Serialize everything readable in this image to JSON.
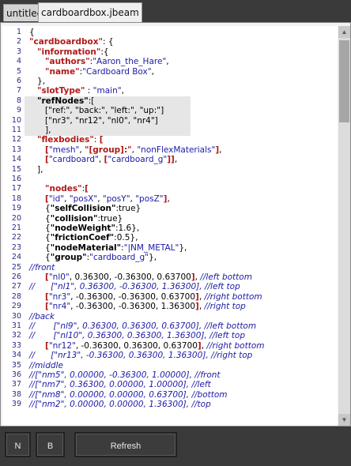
{
  "tabs": [
    {
      "label": "untitled",
      "active": false
    },
    {
      "label": "cardboardbox.jbeam",
      "active": true
    }
  ],
  "buttons": {
    "n": "N",
    "b": "B",
    "refresh": "Refresh"
  },
  "colors": {
    "key": "#b01818",
    "string": "#1a1aa6",
    "comment": "#1a1aa6",
    "linenumber": "#2b2b8a"
  },
  "lines": [
    {
      "n": "1",
      "t": [
        [
          "p",
          "{"
        ]
      ]
    },
    {
      "n": "2",
      "t": [
        [
          "k",
          "\"cardboardbox\""
        ],
        [
          "p",
          ": {"
        ]
      ]
    },
    {
      "n": "3",
      "t": [
        [
          "p",
          "   "
        ],
        [
          "k",
          "\"information\""
        ],
        [
          "p",
          ":{"
        ]
      ]
    },
    {
      "n": "4",
      "t": [
        [
          "p",
          "      "
        ],
        [
          "k",
          "\"authors\""
        ],
        [
          "p",
          ":"
        ],
        [
          "s",
          "\"Aaron_the_Hare\""
        ],
        [
          "p",
          ","
        ]
      ]
    },
    {
      "n": "5",
      "t": [
        [
          "p",
          "      "
        ],
        [
          "k",
          "\"name\""
        ],
        [
          "p",
          ":"
        ],
        [
          "s",
          "\"Cardboard Box\""
        ],
        [
          "p",
          ","
        ]
      ]
    },
    {
      "n": "6",
      "t": [
        [
          "p",
          "   },"
        ]
      ]
    },
    {
      "n": "7",
      "t": [
        [
          "p",
          "   "
        ],
        [
          "k",
          "\"slotType\""
        ],
        [
          "p",
          " : "
        ],
        [
          "s",
          "\"main\""
        ],
        [
          "p",
          ","
        ]
      ]
    },
    {
      "n": "8",
      "hl": true,
      "t": [
        [
          "p",
          "   "
        ],
        [
          "kb",
          "\"refNodes\""
        ],
        [
          "p",
          ":["
        ]
      ]
    },
    {
      "n": "9",
      "hl": true,
      "t": [
        [
          "p",
          "      [\"ref:\", \"back:\", \"left:\", \"up:\"]"
        ]
      ]
    },
    {
      "n": "10",
      "hl": true,
      "t": [
        [
          "p",
          "      [\"nr3\", \"nr12\", \"nl0\", \"nr4\"]"
        ]
      ]
    },
    {
      "n": "11",
      "hl": true,
      "t": [
        [
          "p",
          "      ],"
        ]
      ]
    },
    {
      "n": "12",
      "t": [
        [
          "p",
          "   "
        ],
        [
          "k",
          "\"flexbodies\""
        ],
        [
          "p",
          ": "
        ],
        [
          "o",
          "["
        ]
      ]
    },
    {
      "n": "13",
      "t": [
        [
          "p",
          "      "
        ],
        [
          "o",
          "["
        ],
        [
          "s",
          "\"mesh\""
        ],
        [
          "p",
          ", "
        ],
        [
          "o",
          "\"[group]:\""
        ],
        [
          "p",
          ", "
        ],
        [
          "s",
          "\"nonFlexMaterials\""
        ],
        [
          "o",
          "]"
        ],
        [
          "p",
          ","
        ]
      ]
    },
    {
      "n": "14",
      "t": [
        [
          "p",
          "      "
        ],
        [
          "o",
          "["
        ],
        [
          "s",
          "\"cardboard\""
        ],
        [
          "p",
          ", "
        ],
        [
          "o",
          "["
        ],
        [
          "s",
          "\"cardboard_g\""
        ],
        [
          "o",
          "]]"
        ],
        [
          "p",
          ","
        ]
      ]
    },
    {
      "n": "15",
      "t": [
        [
          "p",
          "   ],"
        ]
      ]
    },
    {
      "n": "16",
      "t": [
        [
          "p",
          ""
        ]
      ]
    },
    {
      "n": "17",
      "t": [
        [
          "p",
          "      "
        ],
        [
          "k",
          "\"nodes\""
        ],
        [
          "p",
          ":"
        ],
        [
          "o",
          "["
        ]
      ]
    },
    {
      "n": "18",
      "t": [
        [
          "p",
          "      "
        ],
        [
          "o",
          "["
        ],
        [
          "s",
          "\"id\""
        ],
        [
          "p",
          ", "
        ],
        [
          "s",
          "\"posX\""
        ],
        [
          "p",
          ", "
        ],
        [
          "s",
          "\"posY\""
        ],
        [
          "p",
          ", "
        ],
        [
          "s",
          "\"posZ\""
        ],
        [
          "o",
          "]"
        ],
        [
          "p",
          ","
        ]
      ]
    },
    {
      "n": "19",
      "t": [
        [
          "p",
          "      {"
        ],
        [
          "kb",
          "\"selfCollision\""
        ],
        [
          "p",
          ":true}"
        ]
      ]
    },
    {
      "n": "20",
      "t": [
        [
          "p",
          "      {"
        ],
        [
          "kb",
          "\"collision\""
        ],
        [
          "p",
          ":true}"
        ]
      ]
    },
    {
      "n": "21",
      "t": [
        [
          "p",
          "      {"
        ],
        [
          "kb",
          "\"nodeWeight\""
        ],
        [
          "p",
          ":1.6},"
        ]
      ]
    },
    {
      "n": "22",
      "t": [
        [
          "p",
          "      {"
        ],
        [
          "kb",
          "\"frictionCoef\""
        ],
        [
          "p",
          ":0.5},"
        ]
      ]
    },
    {
      "n": "23",
      "t": [
        [
          "p",
          "      {"
        ],
        [
          "kb",
          "\"nodeMaterial\""
        ],
        [
          "p",
          ":"
        ],
        [
          "s",
          "\"|NM_METAL\""
        ],
        [
          "p",
          "},"
        ]
      ]
    },
    {
      "n": "24",
      "t": [
        [
          "p",
          "      {"
        ],
        [
          "kb",
          "\"group\""
        ],
        [
          "p",
          ":"
        ],
        [
          "s",
          "\"cardboard_g\""
        ],
        [
          "p",
          "},"
        ]
      ]
    },
    {
      "n": "25",
      "t": [
        [
          "c",
          "//front"
        ]
      ]
    },
    {
      "n": "26",
      "t": [
        [
          "p",
          "      "
        ],
        [
          "o",
          "["
        ],
        [
          "s",
          "\"nl0\""
        ],
        [
          "p",
          ", 0.36300, -0.36300, 0.63700"
        ],
        [
          "o",
          "]"
        ],
        [
          "p",
          ", "
        ],
        [
          "c",
          "//left bottom"
        ]
      ]
    },
    {
      "n": "27",
      "t": [
        [
          "c",
          "//      [\"nl1\", 0.36300, -0.36300, 1.36300], //left top"
        ]
      ]
    },
    {
      "n": "28",
      "t": [
        [
          "p",
          "      "
        ],
        [
          "o",
          "["
        ],
        [
          "s",
          "\"nr3\""
        ],
        [
          "p",
          ", -0.36300, -0.36300, 0.63700"
        ],
        [
          "o",
          "]"
        ],
        [
          "p",
          ", "
        ],
        [
          "c",
          "//right bottom"
        ]
      ]
    },
    {
      "n": "29",
      "t": [
        [
          "p",
          "      "
        ],
        [
          "o",
          "["
        ],
        [
          "s",
          "\"nr4\""
        ],
        [
          "p",
          ", -0.36300, -0.36300, 1.36300"
        ],
        [
          "o",
          "]"
        ],
        [
          "p",
          ", "
        ],
        [
          "c",
          "//right top"
        ]
      ]
    },
    {
      "n": "30",
      "t": [
        [
          "c",
          "//back"
        ]
      ]
    },
    {
      "n": "31",
      "t": [
        [
          "c",
          "//       [\"nl9\", 0.36300, 0.36300, 0.63700], //left bottom"
        ]
      ]
    },
    {
      "n": "32",
      "t": [
        [
          "c",
          "//       [\"nl10\", 0.36300, 0.36300, 1.36300], //left top"
        ]
      ]
    },
    {
      "n": "33",
      "t": [
        [
          "p",
          "      "
        ],
        [
          "o",
          "["
        ],
        [
          "s",
          "\"nr12\""
        ],
        [
          "p",
          ", -0.36300, 0.36300, 0.63700"
        ],
        [
          "o",
          "]"
        ],
        [
          "p",
          ", "
        ],
        [
          "c",
          "//right bottom"
        ]
      ]
    },
    {
      "n": "34",
      "t": [
        [
          "c",
          "//      [\"nr13\", -0.36300, 0.36300, 1.36300], //right top"
        ]
      ]
    },
    {
      "n": "35",
      "t": [
        [
          "c",
          "//middle"
        ]
      ]
    },
    {
      "n": "36",
      "t": [
        [
          "c",
          "//[\"nm5\", 0.00000, -0.36300, 1.00000], //front"
        ]
      ]
    },
    {
      "n": "37",
      "t": [
        [
          "c",
          "//[\"nm7\", 0.36300, 0.00000, 1.00000], //left"
        ]
      ]
    },
    {
      "n": "38",
      "t": [
        [
          "c",
          "//[\"nm8\", 0.00000, 0.00000, 0.63700], //bottom"
        ]
      ]
    },
    {
      "n": "39",
      "t": [
        [
          "c",
          "//[\"nm2\", 0.00000, 0.00000, 1.36300], //top"
        ]
      ]
    }
  ]
}
